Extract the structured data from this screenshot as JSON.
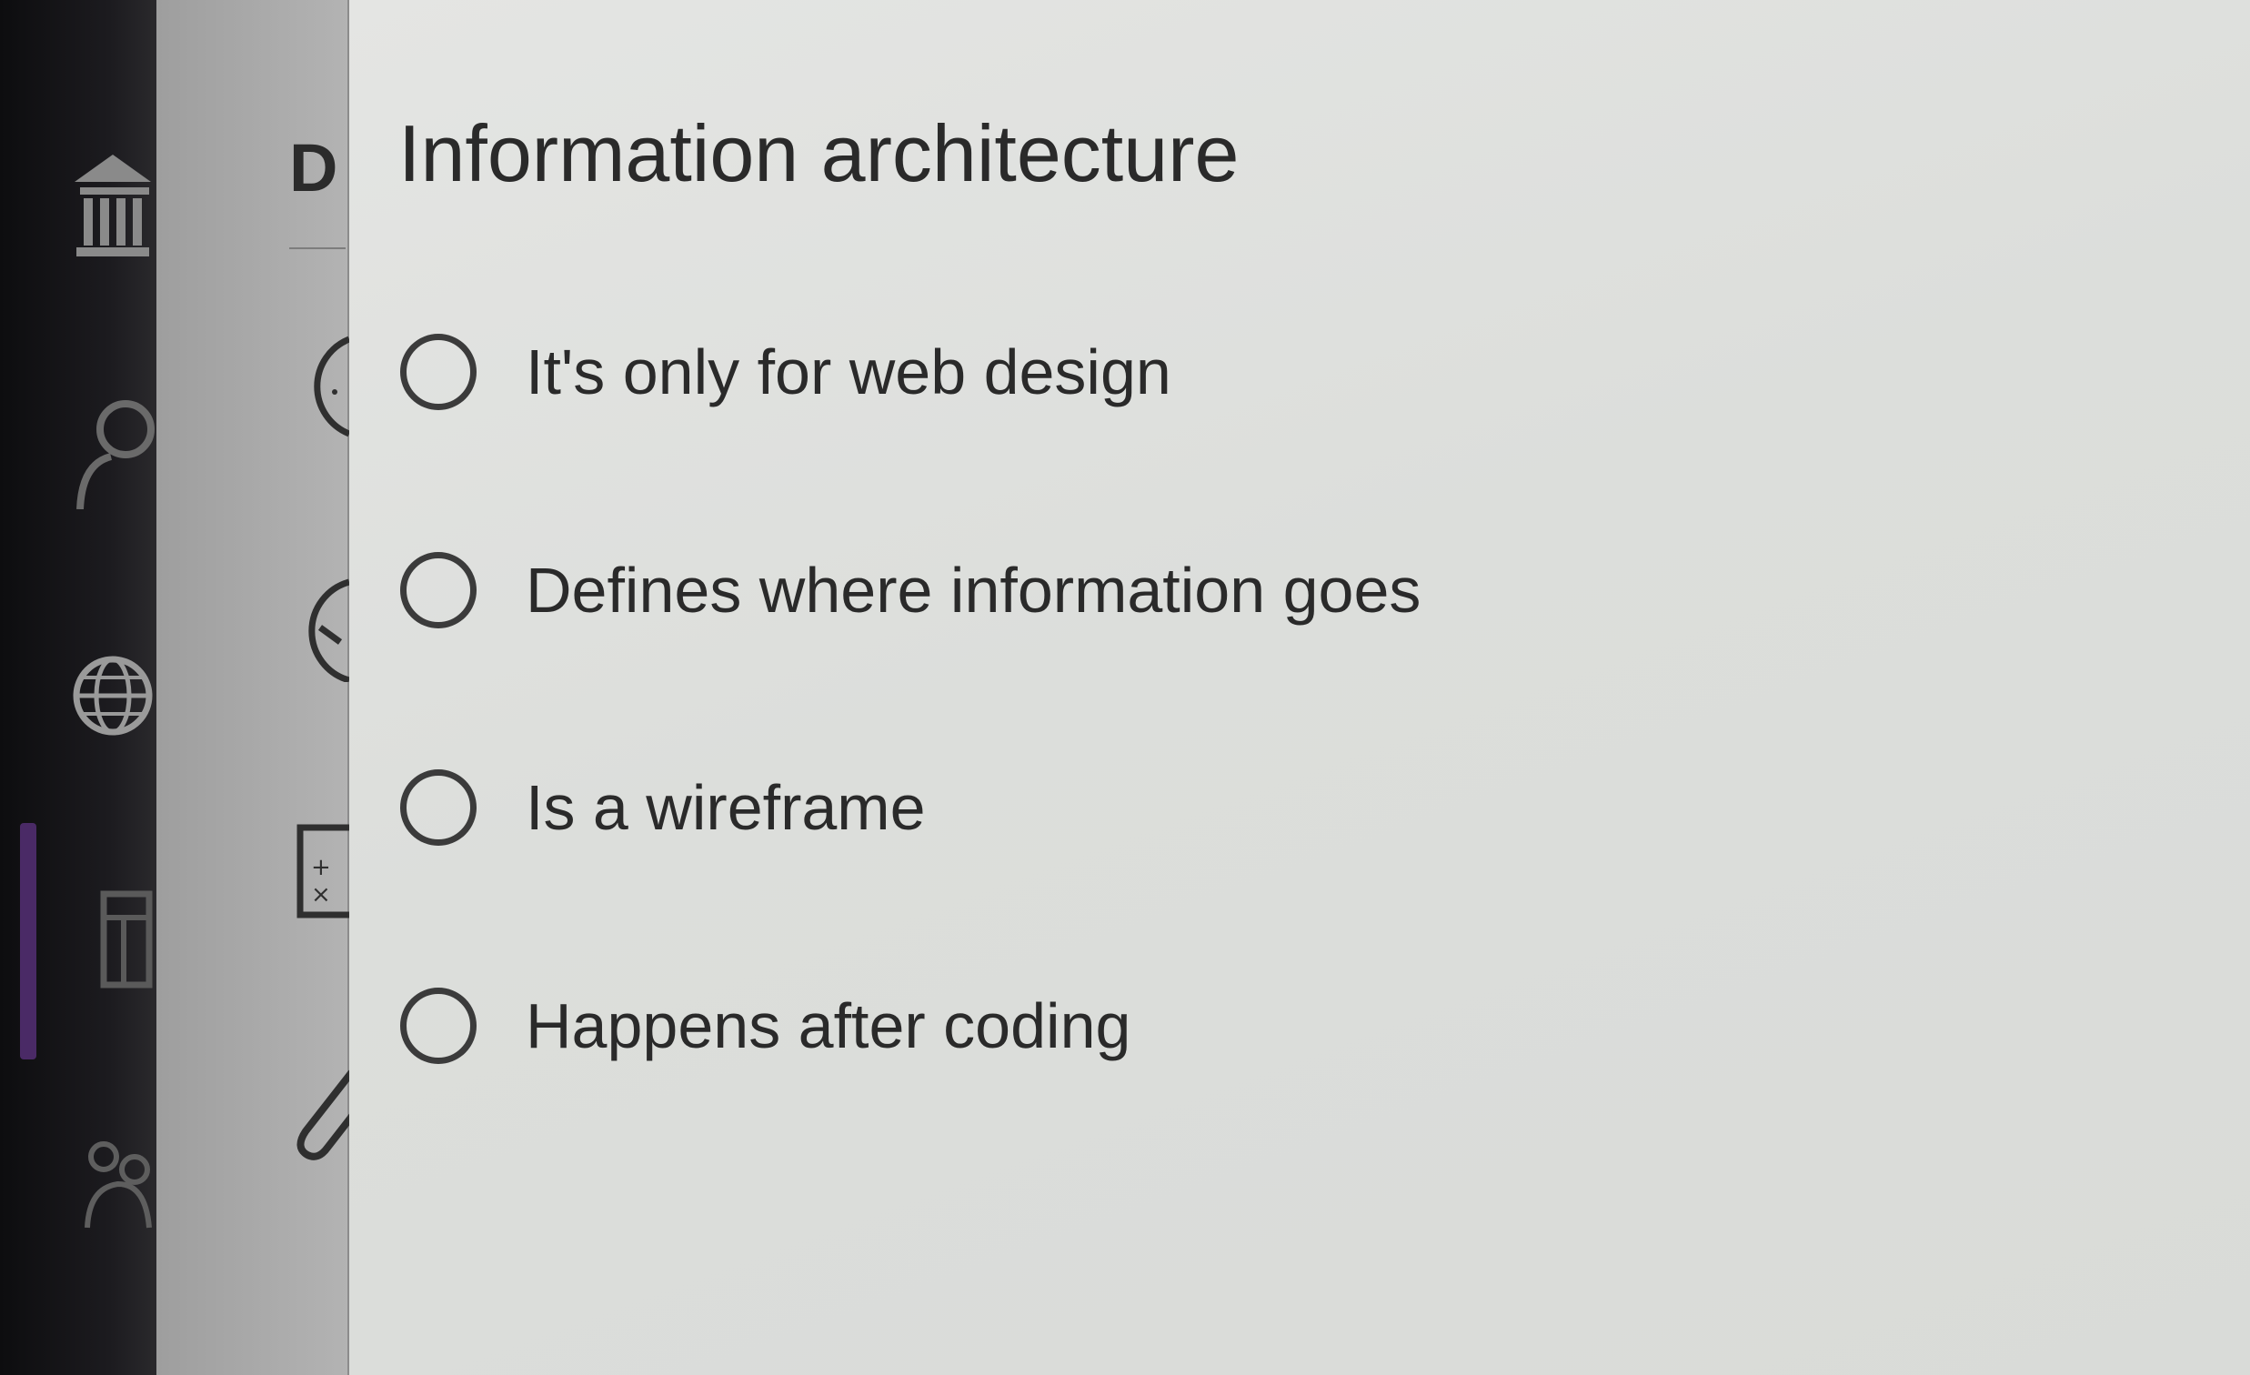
{
  "side_panel": {
    "heading_letter": "D"
  },
  "question": {
    "title": "Information architecture",
    "options": [
      {
        "label": "It's only for web design"
      },
      {
        "label": "Defines where information goes"
      },
      {
        "label": "Is a wireframe"
      },
      {
        "label": "Happens after coding"
      }
    ]
  },
  "icons": {
    "rail": [
      "institution-icon",
      "person-icon",
      "globe-icon",
      "layout-icon",
      "people-icon"
    ],
    "panel": [
      "clock-icon",
      "progress-icon",
      "calculator-icon",
      "attachment-icon"
    ]
  },
  "colors": {
    "rail_background": "#1c1b1f",
    "rail_accent": "#4a2a66",
    "panel_background": "#aaaaaa",
    "content_background": "#dedfdd",
    "text": "#2a2a2a"
  }
}
